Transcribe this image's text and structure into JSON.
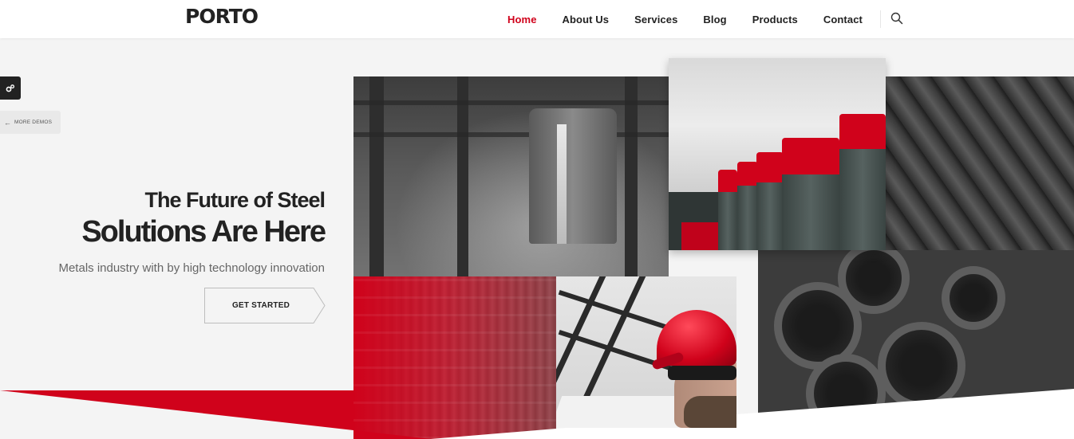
{
  "brand": {
    "logo_text": "PORTO"
  },
  "nav": {
    "items": [
      {
        "label": "Home",
        "active": true
      },
      {
        "label": "About Us",
        "active": false
      },
      {
        "label": "Services",
        "active": false
      },
      {
        "label": "Blog",
        "active": false
      },
      {
        "label": "Products",
        "active": false
      },
      {
        "label": "Contact",
        "active": false
      }
    ],
    "search_icon": "search-icon"
  },
  "sidebar": {
    "demos_label": "MORE DEMOS",
    "gear_icon": "gears-icon",
    "arrow_icon": "arrow-left-icon"
  },
  "hero": {
    "title_line1": "The Future of Steel",
    "title_line2": "Solutions Are Here",
    "subtitle": "Metals industry with by high technology innovation",
    "cta_label": "GET STARTED"
  },
  "colors": {
    "accent": "#d0021b",
    "text_dark": "#222222",
    "panel_bg": "#f4f4f4"
  }
}
